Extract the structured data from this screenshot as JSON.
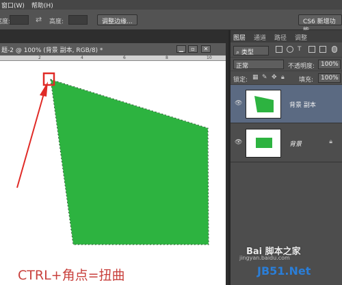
{
  "menu": [
    "窗口(W)",
    "帮助(H)"
  ],
  "options": {
    "width_label": "宽度:",
    "height_label": "高度:",
    "refine_edge_label": "调整边缘...",
    "workspace_label": "CS6 新增功能"
  },
  "document": {
    "tab_title": "题-2 @ 100% (背景 副本, RGB/8) *",
    "ruler_ticks": [
      "2",
      "4",
      "6",
      "8",
      "10"
    ],
    "caption": "CTRL+角点=扭曲",
    "colors": {
      "shape": "#2db340",
      "annotation": "#e02a26",
      "canvas": "#ffffff"
    }
  },
  "layers_panel": {
    "tabs": [
      "图层",
      "通道",
      "路径",
      "调整"
    ],
    "filter_kind": "类型",
    "blend_mode": "正常",
    "opacity_label": "不透明度:",
    "opacity_value": "100%",
    "lock_label": "锁定:",
    "fill_label": "填充:",
    "fill_value": "100%",
    "layers": [
      {
        "name": "背景 副本",
        "visible": true,
        "selected": true
      },
      {
        "name": "背景",
        "visible": true,
        "locked": true
      }
    ]
  },
  "watermark": {
    "site": "Bai 脚本之家",
    "url": "jingyan.baidu.com",
    "brand": "JB51.Net"
  }
}
